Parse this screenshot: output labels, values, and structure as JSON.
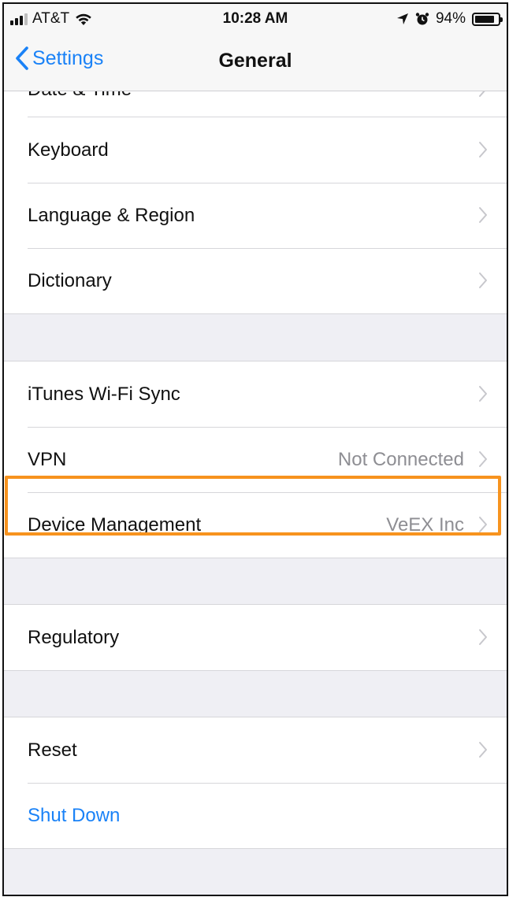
{
  "status_bar": {
    "carrier": "AT&T",
    "time": "10:28 AM",
    "battery_percent": "94%",
    "battery_level": 0.94,
    "icons": [
      "signal-icon",
      "wifi-icon",
      "location-icon",
      "alarm-icon",
      "battery-icon"
    ]
  },
  "nav": {
    "back_label": "Settings",
    "title": "General"
  },
  "partial_row": {
    "label": "Date & Time"
  },
  "groups": [
    {
      "rows": [
        {
          "label": "Keyboard",
          "detail": ""
        },
        {
          "label": "Language & Region",
          "detail": ""
        },
        {
          "label": "Dictionary",
          "detail": ""
        }
      ]
    },
    {
      "rows": [
        {
          "label": "iTunes Wi-Fi Sync",
          "detail": ""
        },
        {
          "label": "VPN",
          "detail": "Not Connected"
        },
        {
          "label": "Device Management",
          "detail": "VeEX Inc"
        }
      ]
    },
    {
      "rows": [
        {
          "label": "Regulatory",
          "detail": ""
        }
      ]
    },
    {
      "rows": [
        {
          "label": "Reset",
          "detail": ""
        },
        {
          "label": "Shut Down",
          "detail": ""
        }
      ]
    }
  ],
  "colors": {
    "accent": "#1a82f7",
    "highlight": "#f7931e",
    "background": "#efeff4"
  }
}
